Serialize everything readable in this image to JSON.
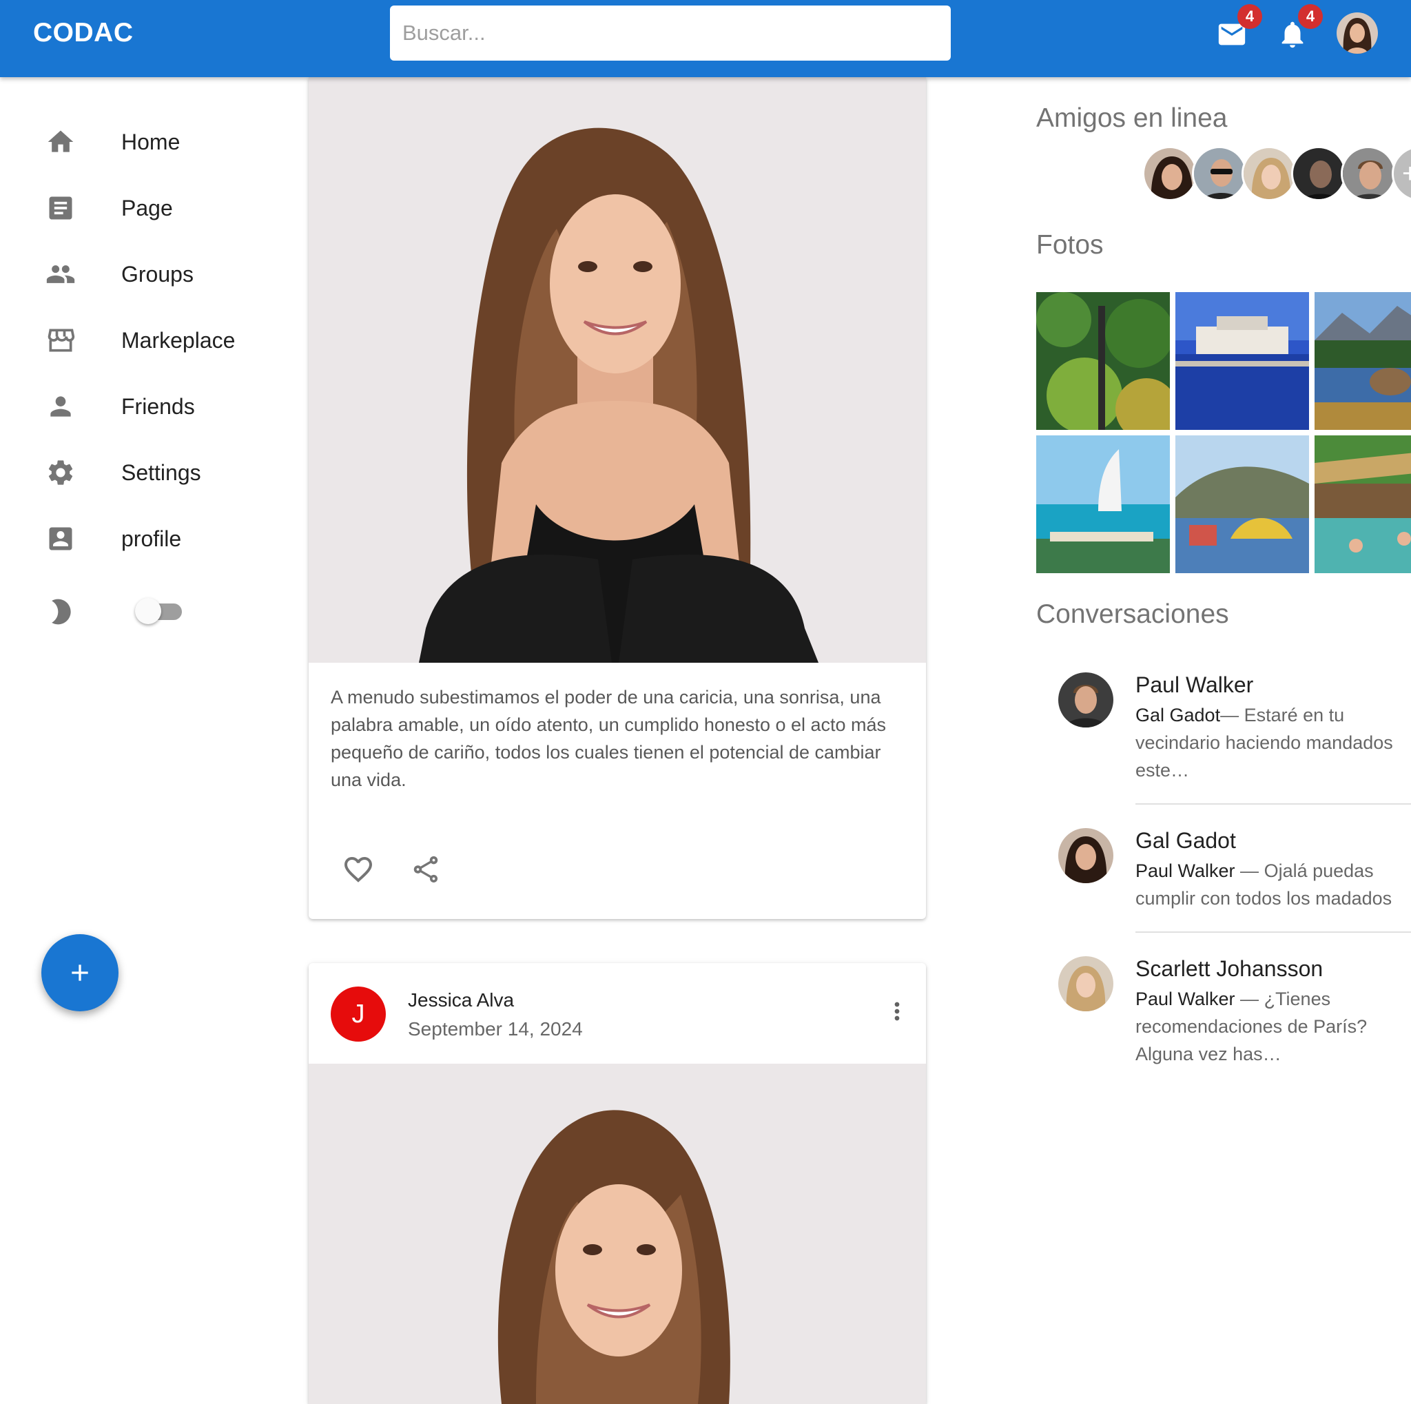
{
  "app": {
    "brand": "CODAC"
  },
  "search": {
    "placeholder": "Buscar..."
  },
  "header": {
    "mail_badge": "4",
    "notifications_badge": "4",
    "icons": [
      "mail-icon",
      "notifications-icon",
      "avatar"
    ]
  },
  "sidebar": {
    "items": [
      {
        "label": "Home",
        "icon": "home-icon"
      },
      {
        "label": "Page",
        "icon": "article-icon"
      },
      {
        "label": "Groups",
        "icon": "people-icon"
      },
      {
        "label": "Markeplace",
        "icon": "storefront-icon"
      },
      {
        "label": "Friends",
        "icon": "person-icon"
      },
      {
        "label": "Settings",
        "icon": "gear-icon"
      },
      {
        "label": "profile",
        "icon": "account-box-icon"
      }
    ],
    "dark_mode": {
      "icon": "moon-icon",
      "enabled": false
    },
    "fab_icon": "plus-icon"
  },
  "feed": {
    "posts": [
      {
        "text": "A menudo subestimamos el poder de una caricia, una sonrisa, una palabra amable, un oído atento, un cumplido honesto o el acto más pequeño de cariño, todos los cuales tienen el potencial de cambiar una vida.",
        "actions": [
          "heart-icon",
          "share-icon"
        ]
      },
      {
        "author_initial": "J",
        "author": "Jessica Alva",
        "date": "September 14, 2024",
        "menu_icon": "more-vert-icon"
      }
    ]
  },
  "right": {
    "online_title": "Amigos en linea",
    "photos_title": "Fotos",
    "conversations_title": "Conversaciones",
    "conversations": [
      {
        "name": "Paul Walker",
        "from": "Gal Gadot",
        "sep": "— ",
        "text": "Estaré en tu vecindario haciendo mandados este…"
      },
      {
        "name": "Gal Gadot",
        "from": "Paul Walker",
        "sep": " — ",
        "text": "Ojalá puedas cumplir con todos los madados"
      },
      {
        "name": "Scarlett Johansson",
        "from": "Paul Walker",
        "sep": " — ",
        "text": "¿Tienes recomendaciones de París? Alguna vez has…"
      }
    ]
  },
  "colors": {
    "primary": "#1976d2",
    "badge": "#d32f2f",
    "avatar_red": "#e60c0c"
  }
}
